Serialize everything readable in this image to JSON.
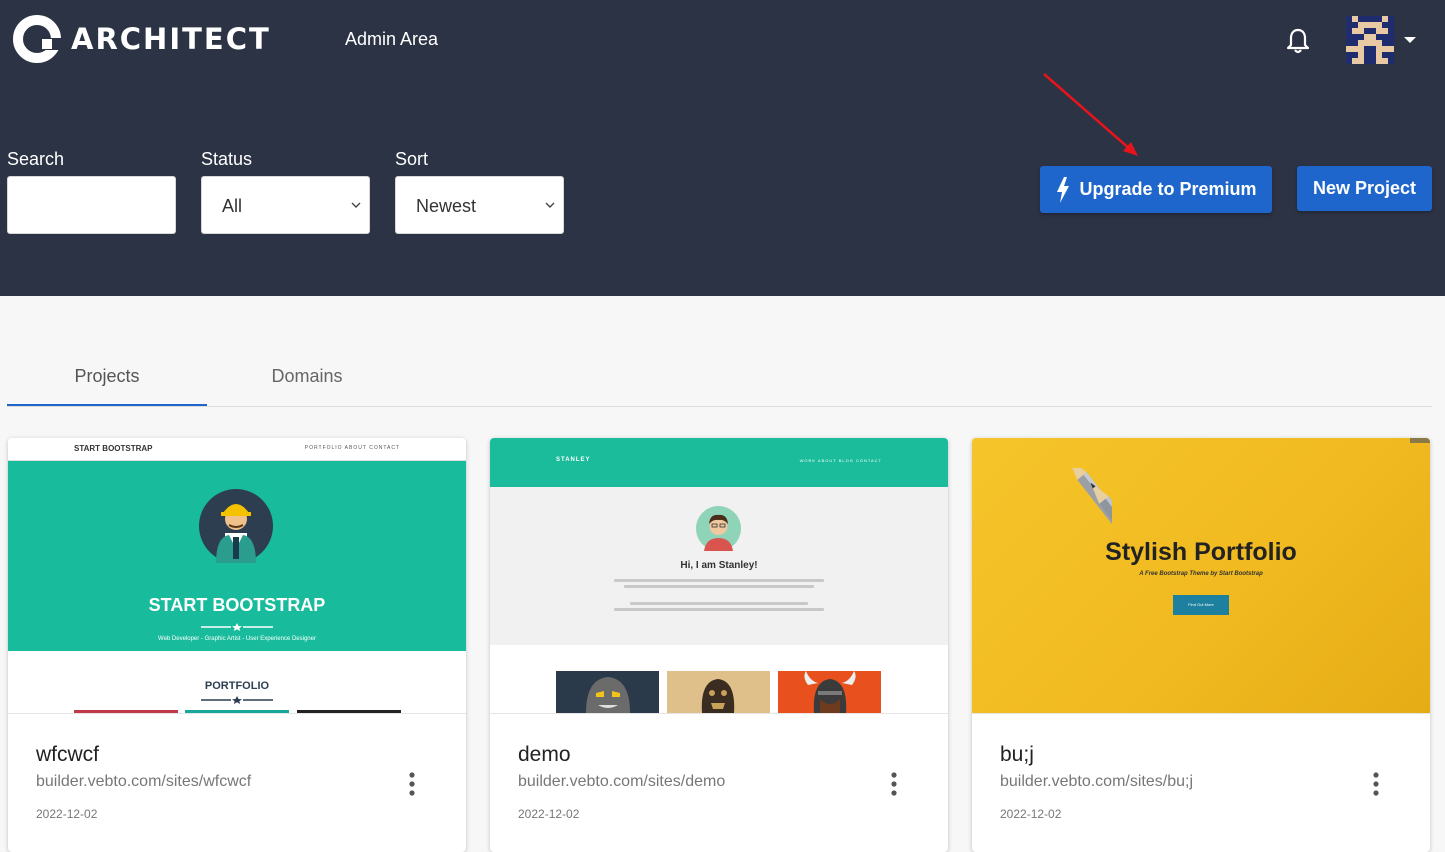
{
  "header": {
    "logo_text": "ARCHITECT",
    "admin_link": "Admin Area",
    "bell_icon": "bell-icon",
    "avatar_icon": "pixel-avatar"
  },
  "filters": {
    "search_label": "Search",
    "search_value": "",
    "status_label": "Status",
    "status_value": "All",
    "sort_label": "Sort",
    "sort_value": "Newest"
  },
  "actions": {
    "upgrade_label": "Upgrade to Premium",
    "new_project_label": "New Project"
  },
  "tabs": [
    {
      "label": "Projects",
      "active": true
    },
    {
      "label": "Domains",
      "active": false
    }
  ],
  "projects": [
    {
      "name": "wfcwcf",
      "url": "builder.vebto.com/sites/wfcwcf",
      "date": "2022-12-02",
      "thumb": {
        "brand": "START BOOTSTRAP",
        "nav": "PORTFOLIO   ABOUT   CONTACT",
        "title": "START BOOTSTRAP",
        "subtitle": "Web Developer - Graphic Artist - User Experience Designer",
        "section": "PORTFOLIO"
      }
    },
    {
      "name": "demo",
      "url": "builder.vebto.com/sites/demo",
      "date": "2022-12-02",
      "thumb": {
        "brand": "STANLEY",
        "nav": "WORK   ABOUT   BLOG   CONTACT",
        "title": "Hi, I am Stanley!"
      }
    },
    {
      "name": "bu;j",
      "url": "builder.vebto.com/sites/bu;j",
      "date": "2022-12-02",
      "thumb": {
        "title": "Stylish Portfolio",
        "subtitle": "A Free Bootstrap Theme by Start Bootstrap",
        "button": "Find Out More"
      }
    }
  ],
  "colors": {
    "header_bg": "#2c3345",
    "primary": "#1e66cc",
    "annotation_arrow": "#e8141b"
  }
}
